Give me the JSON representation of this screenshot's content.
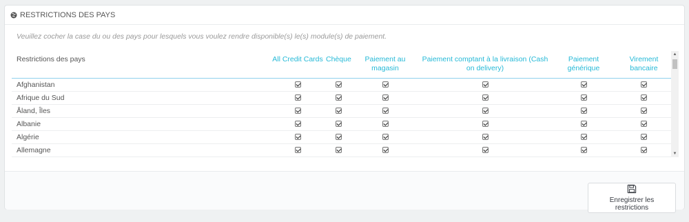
{
  "panel": {
    "title": "Restrictions des pays",
    "hint": "Veuillez cocher la case du ou des pays pour lesquels vous voulez rendre disponible(s) le(s) module(s) de paiement."
  },
  "table": {
    "country_header": "Restrictions des pays",
    "modules": [
      "All Credit Cards",
      "Chèque",
      "Paiement au magasin",
      "Paiement comptant à la livraison (Cash on delivery)",
      "Paiement générique",
      "Virement bancaire"
    ],
    "rows": [
      {
        "country": "Afghanistan",
        "checked": [
          true,
          true,
          true,
          true,
          true,
          true
        ]
      },
      {
        "country": "Afrique du Sud",
        "checked": [
          true,
          true,
          true,
          true,
          true,
          true
        ]
      },
      {
        "country": "Åland, Îles",
        "checked": [
          true,
          true,
          true,
          true,
          true,
          true
        ]
      },
      {
        "country": "Albanie",
        "checked": [
          true,
          true,
          true,
          true,
          true,
          true
        ]
      },
      {
        "country": "Algérie",
        "checked": [
          true,
          true,
          true,
          true,
          true,
          true
        ]
      },
      {
        "country": "Allemagne",
        "checked": [
          true,
          true,
          true,
          true,
          true,
          true
        ]
      },
      {
        "country": "",
        "checked": [
          true,
          true,
          true,
          true,
          true,
          true
        ]
      }
    ]
  },
  "footer": {
    "save_label": "Enregistrer les restrictions"
  },
  "icons": {
    "heading": "globe-icon",
    "save": "floppy-disk-icon"
  },
  "colors": {
    "accent": "#25b9d7"
  }
}
